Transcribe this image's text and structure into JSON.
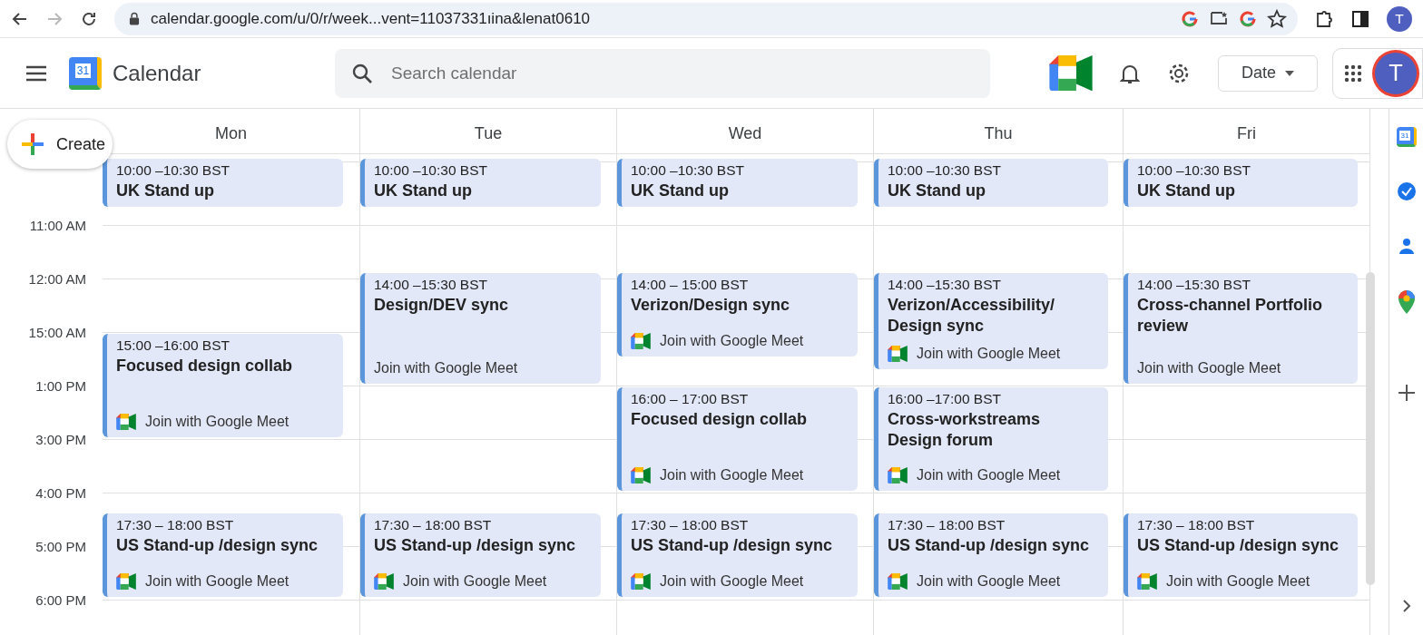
{
  "browser": {
    "url": "calendar.google.com/u/0/r/week...vent=11037331ıina&lenat0610",
    "forward_disabled": true,
    "avatar": "T"
  },
  "app": {
    "logo_day": "31",
    "title": "Calendar",
    "search": {
      "placeholder": "Search calendar"
    },
    "view_button": "Date",
    "avatar": "T"
  },
  "create_button": "Create",
  "time_labels": [
    "11:00 AM",
    "12:00 AM",
    "15:00 AM",
    "1:00 PM",
    "3:00 PM",
    "4:00 PM",
    "5:00 PM",
    "6:00 PM"
  ],
  "side_panel": {
    "logo_day": "31"
  },
  "days": [
    {
      "name": "Mon",
      "events": [
        {
          "time": "10:00 –10:30 BST",
          "title": "UK Stand up"
        },
        {
          "time": "15:00 –16:00 BST",
          "title": "Focused design collab",
          "join": {
            "label": "Join with Google Meet",
            "icon": true
          }
        },
        {
          "time": "17:30 – 18:00 BST",
          "title": "US Stand-up /design sync",
          "join": {
            "label": "Join with Google Meet",
            "icon": true
          }
        }
      ]
    },
    {
      "name": "Tue",
      "events": [
        {
          "time": "10:00 –10:30 BST",
          "title": "UK Stand up"
        },
        {
          "time": "14:00 –15:30 BST",
          "title": "Design/DEV sync",
          "join": {
            "label": "Join with Google Meet",
            "icon": false
          }
        },
        {
          "time": "17:30 – 18:00 BST",
          "title": "US Stand-up /design sync",
          "join": {
            "label": "Join with Google Meet",
            "icon": true
          }
        }
      ]
    },
    {
      "name": "Wed",
      "events": [
        {
          "time": "10:00 –10:30 BST",
          "title": "UK Stand up"
        },
        {
          "time": "14:00 – 15:00 BST",
          "title": "Verizon/Design sync",
          "join": {
            "label": "Join with Google Meet",
            "icon": true
          }
        },
        {
          "time": "16:00 – 17:00 BST",
          "title": "Focused design collab",
          "join": {
            "label": "Join with Google Meet",
            "icon": true
          }
        },
        {
          "time": "17:30 – 18:00 BST",
          "title": "US Stand-up /design sync",
          "join": {
            "label": "Join with Google Meet",
            "icon": true
          }
        }
      ]
    },
    {
      "name": "Thu",
      "events": [
        {
          "time": "10:00 –10:30 BST",
          "title": "UK Stand up"
        },
        {
          "time": "14:00 –15:30 BST",
          "title": "Verizon/Accessibility/ Design sync",
          "join": {
            "label": "Join with Google Meet",
            "icon": true
          }
        },
        {
          "time": "16:00 –17:00 BST",
          "title": "Cross-workstreams Design forum",
          "join": {
            "label": "Join with Google Meet",
            "icon": true
          }
        },
        {
          "time": "17:30 – 18:00 BST",
          "title": "US Stand-up /design sync",
          "join": {
            "label": "Join with Google Meet",
            "icon": true
          }
        }
      ]
    },
    {
      "name": "Fri",
      "events": [
        {
          "time": "10:00 –10:30 BST",
          "title": "UK Stand up"
        },
        {
          "time": "14:00 –15:30 BST",
          "title": "Cross-channel Portfolio review",
          "join": {
            "label": "Join with Google Meet",
            "icon": false
          }
        },
        {
          "time": "17:30 – 18:00 BST",
          "title": "US Stand-up /design sync",
          "join": {
            "label": "Join with Google Meet",
            "icon": true
          }
        }
      ]
    }
  ]
}
